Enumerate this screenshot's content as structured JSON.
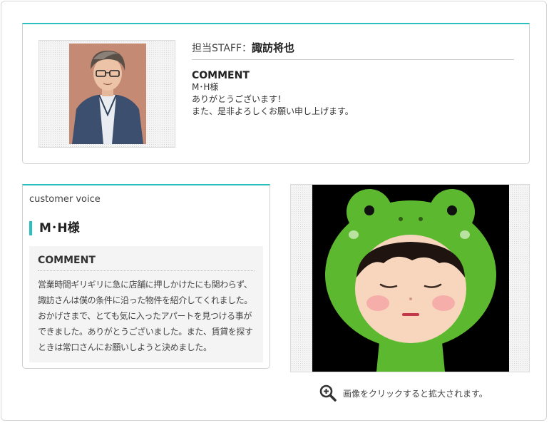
{
  "staff": {
    "label": "担当STAFF：",
    "name": "諏訪将也",
    "comment_title": "COMMENT",
    "comment_lines": [
      "M･H様",
      "ありがとうございます！",
      "また、是非よろしくお願い申し上げます。"
    ]
  },
  "voice": {
    "label": "customer voice",
    "customer_name": "M･H様",
    "comment_title": "COMMENT",
    "comment_text": "営業時間ギリギリに急に店舗に押しかけたにも関わらず、諏訪さんは僕の条件に沿った物件を紹介してくれました。おかげさまで、とても気に入ったアパートを見つける事ができました。ありがとうございました。また、賃貸を探すときは常口さんにお願いしようと決めました。"
  },
  "image": {
    "zoom_text": "画像をクリックすると拡大されます。",
    "zoom_icon": "magnifier-plus-icon"
  },
  "colors": {
    "accent": "#2bbfc0",
    "frog_green": "#5cb92f",
    "panel_bg": "#f4f4f4"
  }
}
